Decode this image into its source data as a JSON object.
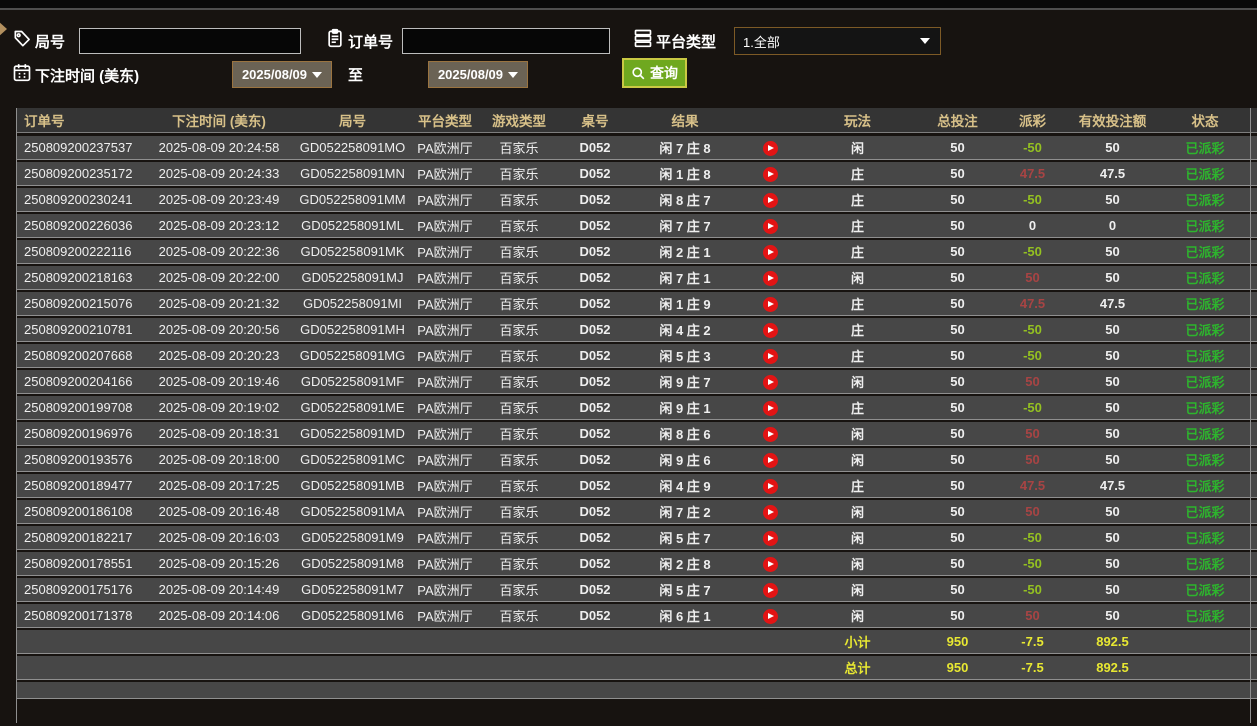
{
  "filters": {
    "round_label": "局号",
    "round_value": "",
    "order_label": "订单号",
    "order_value": "",
    "platform_label": "平台类型",
    "platform_value": "1.全部",
    "bet_time_label": "下注时间 (美东)",
    "date_from": "2025/08/09",
    "to_label": "至",
    "date_to": "2025/08/09",
    "query_label": "查询"
  },
  "table": {
    "headers": [
      "订单号",
      "下注时间 (美东)",
      "局号",
      "平台类型",
      "游戏类型",
      "桌号",
      "结果",
      "",
      "玩法",
      "总投注",
      "派彩",
      "有效投注额",
      "状态",
      ""
    ],
    "rows": [
      {
        "order": "250809200237537",
        "time": "2025-08-09 20:24:58",
        "round": "GD052258091MO",
        "platform": "PA欧洲厅",
        "game": "百家乐",
        "table_no": "D052",
        "result": "闲 7 庄 8",
        "play": "闲",
        "total_bet": "50",
        "payout": "-50",
        "valid_bet": "50",
        "status": "已派彩"
      },
      {
        "order": "250809200235172",
        "time": "2025-08-09 20:24:33",
        "round": "GD052258091MN",
        "platform": "PA欧洲厅",
        "game": "百家乐",
        "table_no": "D052",
        "result": "闲 1 庄 8",
        "play": "庄",
        "total_bet": "50",
        "payout": "47.5",
        "valid_bet": "47.5",
        "status": "已派彩"
      },
      {
        "order": "250809200230241",
        "time": "2025-08-09 20:23:49",
        "round": "GD052258091MM",
        "platform": "PA欧洲厅",
        "game": "百家乐",
        "table_no": "D052",
        "result": "闲 8 庄 7",
        "play": "庄",
        "total_bet": "50",
        "payout": "-50",
        "valid_bet": "50",
        "status": "已派彩"
      },
      {
        "order": "250809200226036",
        "time": "2025-08-09 20:23:12",
        "round": "GD052258091ML",
        "platform": "PA欧洲厅",
        "game": "百家乐",
        "table_no": "D052",
        "result": "闲 7 庄 7",
        "play": "庄",
        "total_bet": "50",
        "payout": "0",
        "valid_bet": "0",
        "status": "已派彩"
      },
      {
        "order": "250809200222116",
        "time": "2025-08-09 20:22:36",
        "round": "GD052258091MK",
        "platform": "PA欧洲厅",
        "game": "百家乐",
        "table_no": "D052",
        "result": "闲 2 庄 1",
        "play": "庄",
        "total_bet": "50",
        "payout": "-50",
        "valid_bet": "50",
        "status": "已派彩"
      },
      {
        "order": "250809200218163",
        "time": "2025-08-09 20:22:00",
        "round": "GD052258091MJ",
        "platform": "PA欧洲厅",
        "game": "百家乐",
        "table_no": "D052",
        "result": "闲 7 庄 1",
        "play": "闲",
        "total_bet": "50",
        "payout": "50",
        "valid_bet": "50",
        "status": "已派彩"
      },
      {
        "order": "250809200215076",
        "time": "2025-08-09 20:21:32",
        "round": "GD052258091MI",
        "platform": "PA欧洲厅",
        "game": "百家乐",
        "table_no": "D052",
        "result": "闲 1 庄 9",
        "play": "庄",
        "total_bet": "50",
        "payout": "47.5",
        "valid_bet": "47.5",
        "status": "已派彩"
      },
      {
        "order": "250809200210781",
        "time": "2025-08-09 20:20:56",
        "round": "GD052258091MH",
        "platform": "PA欧洲厅",
        "game": "百家乐",
        "table_no": "D052",
        "result": "闲 4 庄 2",
        "play": "庄",
        "total_bet": "50",
        "payout": "-50",
        "valid_bet": "50",
        "status": "已派彩"
      },
      {
        "order": "250809200207668",
        "time": "2025-08-09 20:20:23",
        "round": "GD052258091MG",
        "platform": "PA欧洲厅",
        "game": "百家乐",
        "table_no": "D052",
        "result": "闲 5 庄 3",
        "play": "庄",
        "total_bet": "50",
        "payout": "-50",
        "valid_bet": "50",
        "status": "已派彩"
      },
      {
        "order": "250809200204166",
        "time": "2025-08-09 20:19:46",
        "round": "GD052258091MF",
        "platform": "PA欧洲厅",
        "game": "百家乐",
        "table_no": "D052",
        "result": "闲 9 庄 7",
        "play": "闲",
        "total_bet": "50",
        "payout": "50",
        "valid_bet": "50",
        "status": "已派彩"
      },
      {
        "order": "250809200199708",
        "time": "2025-08-09 20:19:02",
        "round": "GD052258091ME",
        "platform": "PA欧洲厅",
        "game": "百家乐",
        "table_no": "D052",
        "result": "闲 9 庄 1",
        "play": "庄",
        "total_bet": "50",
        "payout": "-50",
        "valid_bet": "50",
        "status": "已派彩"
      },
      {
        "order": "250809200196976",
        "time": "2025-08-09 20:18:31",
        "round": "GD052258091MD",
        "platform": "PA欧洲厅",
        "game": "百家乐",
        "table_no": "D052",
        "result": "闲 8 庄 6",
        "play": "闲",
        "total_bet": "50",
        "payout": "50",
        "valid_bet": "50",
        "status": "已派彩"
      },
      {
        "order": "250809200193576",
        "time": "2025-08-09 20:18:00",
        "round": "GD052258091MC",
        "platform": "PA欧洲厅",
        "game": "百家乐",
        "table_no": "D052",
        "result": "闲 9 庄 6",
        "play": "闲",
        "total_bet": "50",
        "payout": "50",
        "valid_bet": "50",
        "status": "已派彩"
      },
      {
        "order": "250809200189477",
        "time": "2025-08-09 20:17:25",
        "round": "GD052258091MB",
        "platform": "PA欧洲厅",
        "game": "百家乐",
        "table_no": "D052",
        "result": "闲 4 庄 9",
        "play": "庄",
        "total_bet": "50",
        "payout": "47.5",
        "valid_bet": "47.5",
        "status": "已派彩"
      },
      {
        "order": "250809200186108",
        "time": "2025-08-09 20:16:48",
        "round": "GD052258091MA",
        "platform": "PA欧洲厅",
        "game": "百家乐",
        "table_no": "D052",
        "result": "闲 7 庄 2",
        "play": "闲",
        "total_bet": "50",
        "payout": "50",
        "valid_bet": "50",
        "status": "已派彩"
      },
      {
        "order": "250809200182217",
        "time": "2025-08-09 20:16:03",
        "round": "GD052258091M9",
        "platform": "PA欧洲厅",
        "game": "百家乐",
        "table_no": "D052",
        "result": "闲 5 庄 7",
        "play": "闲",
        "total_bet": "50",
        "payout": "-50",
        "valid_bet": "50",
        "status": "已派彩"
      },
      {
        "order": "250809200178551",
        "time": "2025-08-09 20:15:26",
        "round": "GD052258091M8",
        "platform": "PA欧洲厅",
        "game": "百家乐",
        "table_no": "D052",
        "result": "闲 2 庄 8",
        "play": "闲",
        "total_bet": "50",
        "payout": "-50",
        "valid_bet": "50",
        "status": "已派彩"
      },
      {
        "order": "250809200175176",
        "time": "2025-08-09 20:14:49",
        "round": "GD052258091M7",
        "platform": "PA欧洲厅",
        "game": "百家乐",
        "table_no": "D052",
        "result": "闲 5 庄 7",
        "play": "闲",
        "total_bet": "50",
        "payout": "-50",
        "valid_bet": "50",
        "status": "已派彩"
      },
      {
        "order": "250809200171378",
        "time": "2025-08-09 20:14:06",
        "round": "GD052258091M6",
        "platform": "PA欧洲厅",
        "game": "百家乐",
        "table_no": "D052",
        "result": "闲 6 庄 1",
        "play": "闲",
        "total_bet": "50",
        "payout": "50",
        "valid_bet": "50",
        "status": "已派彩"
      }
    ],
    "subtotal": {
      "label": "小计",
      "total_bet": "950",
      "payout": "-7.5",
      "valid_bet": "892.5"
    },
    "total": {
      "label": "总计",
      "total_bet": "950",
      "payout": "-7.5",
      "valid_bet": "892.5"
    }
  },
  "colors": {
    "header_gold": "#d8c189",
    "negative_green": "#94c121",
    "positive_red": "#a84444",
    "status_green": "#2db52d",
    "summary_yellow": "#e8e832",
    "query_green": "#6fa81f"
  }
}
